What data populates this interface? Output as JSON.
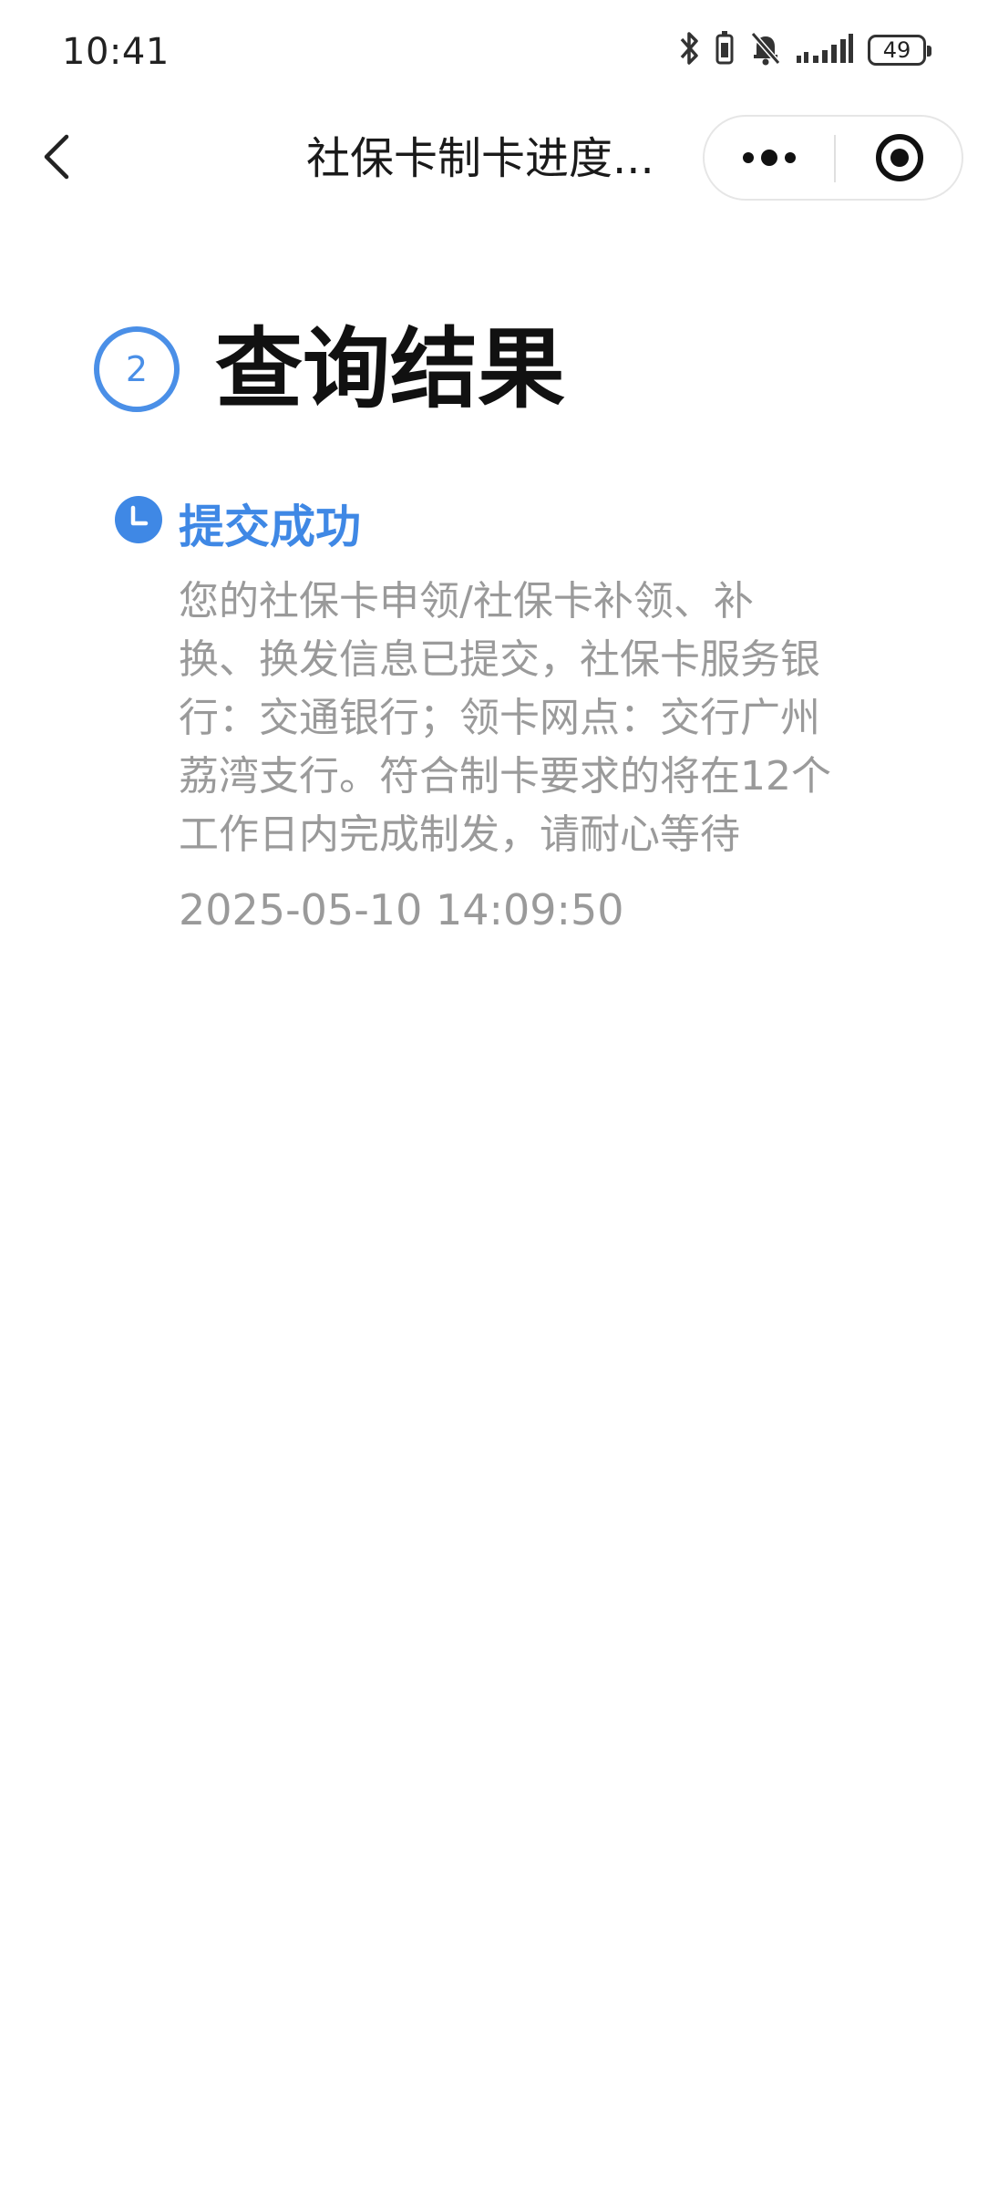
{
  "status_bar": {
    "time": "10:41",
    "battery": "49",
    "icons": [
      "bluetooth-icon",
      "vibrate-icon",
      "mute-bell-icon",
      "signal-icon",
      "battery-icon"
    ]
  },
  "nav": {
    "title": "社保卡制卡进度...",
    "icons": [
      "back-arrow-icon",
      "more-dots-icon",
      "close-target-icon"
    ]
  },
  "result": {
    "step_number": "2",
    "title": "查询结果"
  },
  "timeline": {
    "status_title": "提交成功",
    "description_lines": [
      "您的社保卡申领/社保卡补领、补",
      "换、换发信息已提交，社保卡服务银",
      "行：交通银行；领卡网点：交行广州",
      "荔湾支行。符合制卡要求的将在12个",
      "工作日内完成制发，请耐心等待"
    ],
    "timestamp": "2025-05-10 14:09:50"
  },
  "colors": {
    "accent": "#3f88e5",
    "muted_text": "#9a9a9a"
  }
}
